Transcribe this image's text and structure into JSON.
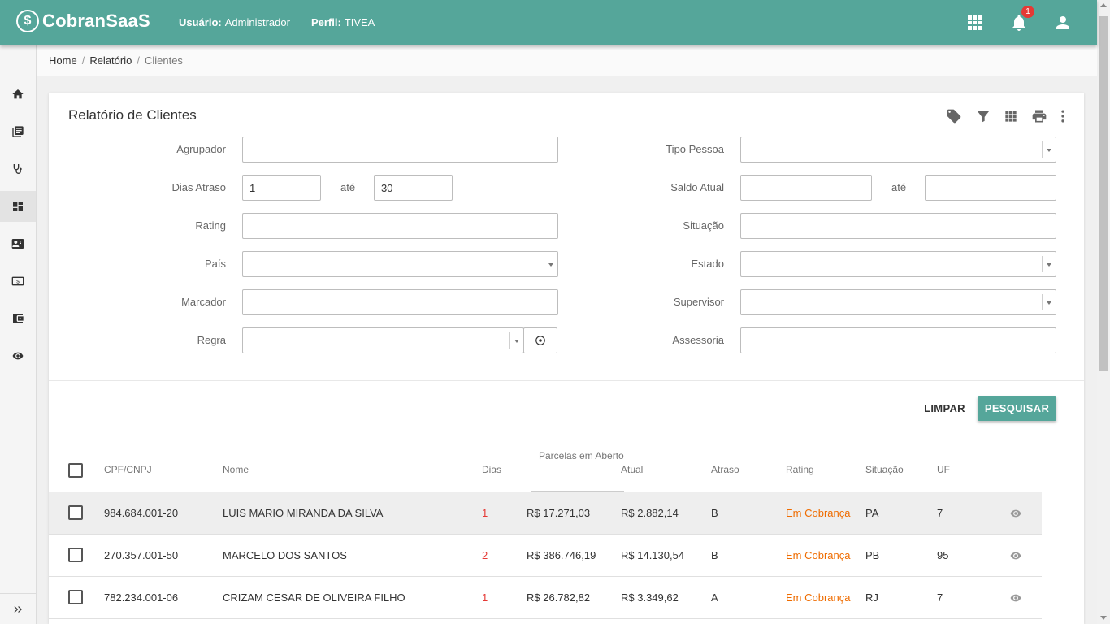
{
  "app": {
    "logo_text": "CobranSaaS",
    "logo_mark": "$"
  },
  "header": {
    "user_label": "Usuário:",
    "user_value": "Administrador",
    "profile_label": "Perfil:",
    "profile_value": "TIVEA",
    "notification_count": "1",
    "icons": [
      "apps-grid-icon",
      "bell-icon",
      "account-icon"
    ],
    "color": "#55a69a"
  },
  "sidebar": {
    "items": [
      {
        "name": "home-icon"
      },
      {
        "name": "book-icon"
      },
      {
        "name": "stethoscope-icon"
      },
      {
        "name": "dashboard-icon",
        "active": true
      },
      {
        "name": "contact-card-icon"
      },
      {
        "name": "money-icon"
      },
      {
        "name": "wallet-icon"
      },
      {
        "name": "eye-icon"
      }
    ],
    "expand_icon": "double-chevron-right-icon"
  },
  "breadcrumb": {
    "items": [
      "Home",
      "Relatório",
      "Clientes"
    ]
  },
  "report": {
    "title": "Relatório de Clientes",
    "toolbar_icons": [
      "tag-icon",
      "filter-icon",
      "grid-icon",
      "print-icon",
      "more-vert-icon"
    ],
    "filters": {
      "agrupador": {
        "label": "Agrupador",
        "value": ""
      },
      "dias_atraso": {
        "label": "Dias Atraso",
        "from": "1",
        "to_label": "até",
        "to": "30"
      },
      "rating": {
        "label": "Rating",
        "value": ""
      },
      "pais": {
        "label": "País",
        "value": ""
      },
      "marcador": {
        "label": "Marcador",
        "value": ""
      },
      "regra": {
        "label": "Regra",
        "value": ""
      },
      "tipo_pessoa": {
        "label": "Tipo Pessoa",
        "value": ""
      },
      "saldo_atual": {
        "label": "Saldo Atual",
        "from": "",
        "to_label": "até",
        "to": ""
      },
      "situacao": {
        "label": "Situação",
        "value": ""
      },
      "estado": {
        "label": "Estado",
        "value": ""
      },
      "supervisor": {
        "label": "Supervisor",
        "value": ""
      },
      "assessoria": {
        "label": "Assessoria",
        "value": ""
      }
    },
    "buttons": {
      "clear": "LIMPAR",
      "search": "PESQUISAR"
    }
  },
  "table": {
    "group_header": "Parcelas em Aberto",
    "columns": {
      "doc": "CPF/CNPJ",
      "name": "Nome",
      "days": "Dias",
      "open": "",
      "current": "Atual",
      "delay": "Atraso",
      "rating": "Rating",
      "situation": "Situação",
      "uf": "UF"
    },
    "rows": [
      {
        "doc": "984.684.001-20",
        "name": "LUIS MARIO MIRANDA DA SILVA",
        "days": "1",
        "open": "R$ 17.271,03",
        "current": "R$ 2.882,14",
        "delay": "B",
        "rating": "Em Cobrança",
        "situation": "PA",
        "uf": "7"
      },
      {
        "doc": "270.357.001-50",
        "name": "MARCELO DOS SANTOS",
        "days": "2",
        "open": "R$ 386.746,19",
        "current": "R$ 14.130,54",
        "delay": "B",
        "rating": "Em Cobrança",
        "situation": "PB",
        "uf": "95"
      },
      {
        "doc": "782.234.001-06",
        "name": "CRIZAM CESAR DE OLIVEIRA FILHO",
        "days": "1",
        "open": "R$ 26.782,82",
        "current": "R$ 3.349,62",
        "delay": "A",
        "rating": "Em Cobrança",
        "situation": "RJ",
        "uf": "7"
      }
    ]
  }
}
